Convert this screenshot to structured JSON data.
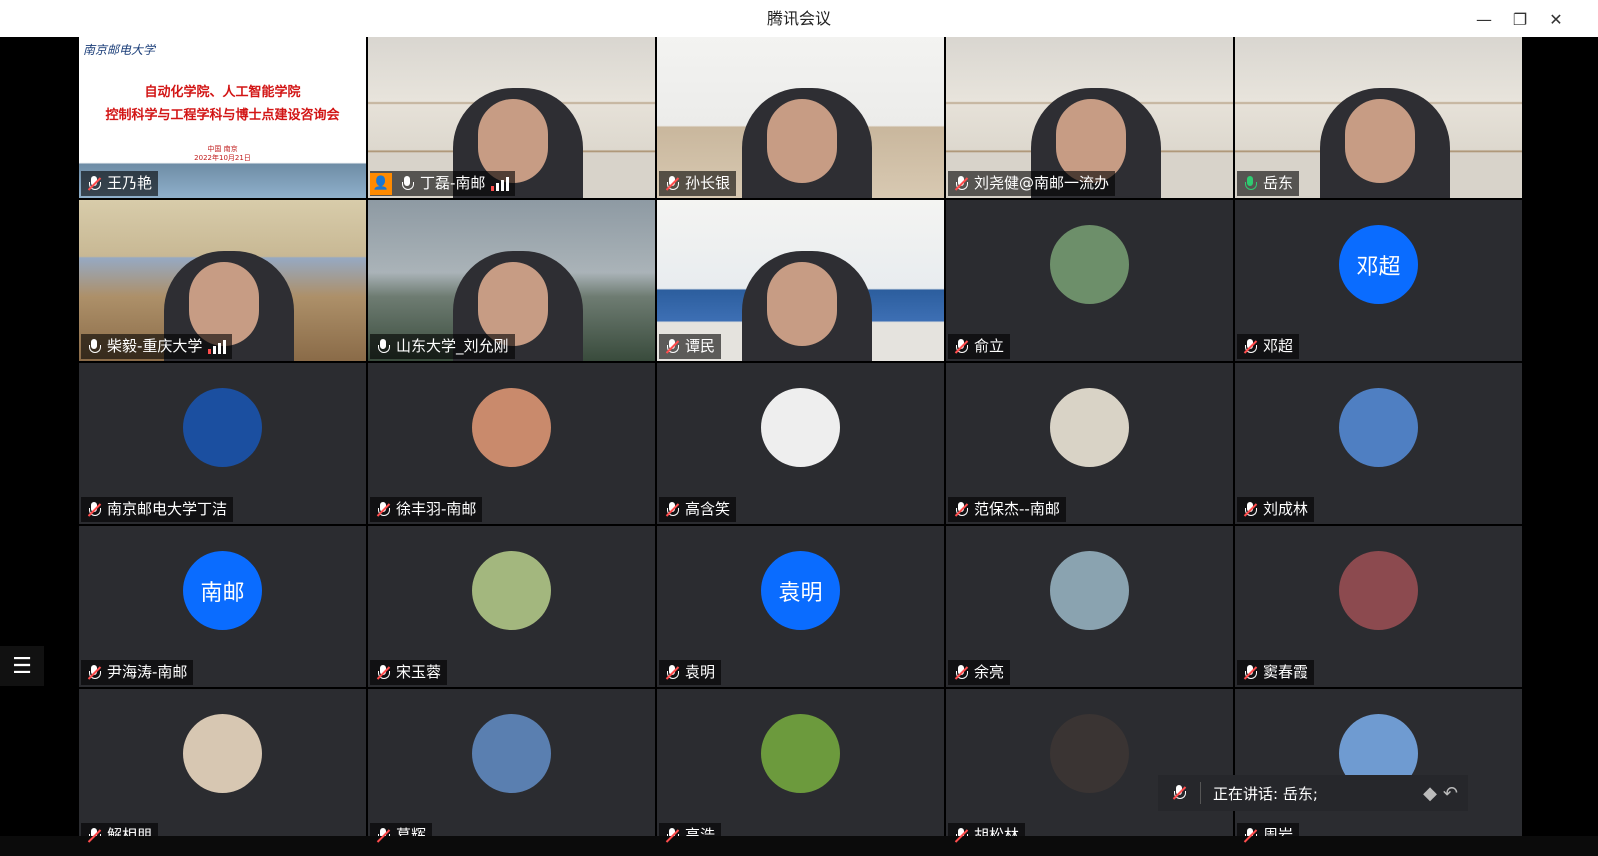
{
  "window": {
    "title": "腾讯会议",
    "minimize_icon": "—",
    "restore_icon": "❐",
    "close_icon": "✕"
  },
  "slide": {
    "logo_text": "南京邮电大学",
    "line1": "自动化学院、人工智能学院",
    "line2": "控制科学与工程学科与博士点建设咨询会",
    "location": "中国 南京",
    "date": "2022年10月21日"
  },
  "participants": [
    {
      "name": "王乃艳",
      "mic": "muted",
      "view": "slide"
    },
    {
      "name": "丁磊-南邮",
      "mic": "on",
      "view": "video",
      "bg": "shelf",
      "host": true,
      "signal": true
    },
    {
      "name": "孙长银",
      "mic": "muted",
      "view": "video",
      "bg": "living"
    },
    {
      "name": "刘尧健@南邮一流办",
      "mic": "muted",
      "view": "video",
      "bg": "shelf"
    },
    {
      "name": "岳东",
      "mic": "active",
      "view": "video",
      "bg": "shelf",
      "speaking": true
    },
    {
      "name": "柴毅-重庆大学",
      "mic": "on",
      "view": "video",
      "bg": "class",
      "signal": true
    },
    {
      "name": "山东大学_刘允刚",
      "mic": "on",
      "view": "video",
      "bg": "mount"
    },
    {
      "name": "谭民",
      "mic": "muted",
      "view": "video",
      "bg": "office"
    },
    {
      "name": "俞立",
      "mic": "muted",
      "view": "avatar",
      "avatar_color": "#6d8f6a"
    },
    {
      "name": "邓超",
      "mic": "muted",
      "view": "avatar-text",
      "avatar_text": "邓超"
    },
    {
      "name": "南京邮电大学丁洁",
      "mic": "muted",
      "view": "avatar",
      "avatar_color": "#1b4fa0"
    },
    {
      "name": "徐丰羽-南邮",
      "mic": "muted",
      "view": "avatar",
      "avatar_color": "#c98a6c"
    },
    {
      "name": "高含笑",
      "mic": "muted",
      "view": "avatar",
      "avatar_color": "#eeeeee"
    },
    {
      "name": "范保杰--南邮",
      "mic": "muted",
      "view": "avatar",
      "avatar_color": "#d9d3c6"
    },
    {
      "name": "刘成林",
      "mic": "muted",
      "view": "avatar",
      "avatar_color": "#4f7fc2"
    },
    {
      "name": "尹海涛-南邮",
      "mic": "muted",
      "view": "avatar-text",
      "avatar_text": "南邮"
    },
    {
      "name": "宋玉蓉",
      "mic": "muted",
      "view": "avatar",
      "avatar_color": "#a3b77e"
    },
    {
      "name": "袁明",
      "mic": "muted",
      "view": "avatar-text",
      "avatar_text": "袁明"
    },
    {
      "name": "余亮",
      "mic": "muted",
      "view": "avatar",
      "avatar_color": "#8aa3b0"
    },
    {
      "name": "窦春霞",
      "mic": "muted",
      "view": "avatar",
      "avatar_color": "#8c4a4f"
    },
    {
      "name": "解相朋",
      "mic": "muted",
      "view": "avatar",
      "avatar_color": "#d7c7b2"
    },
    {
      "name": "葛辉",
      "mic": "muted",
      "view": "avatar",
      "avatar_color": "#5a7fb0"
    },
    {
      "name": "高浩",
      "mic": "muted",
      "view": "avatar",
      "avatar_color": "#6c9a3d"
    },
    {
      "name": "胡松林",
      "mic": "muted",
      "view": "avatar",
      "avatar_color": "#3a3433"
    },
    {
      "name": "周岩",
      "mic": "muted",
      "view": "avatar",
      "avatar_color": "#6f9bd1"
    }
  ],
  "speaker_bar": {
    "text": "正在讲话: 岳东;",
    "mic_icon": "muted"
  },
  "side_list": {
    "icon": "☰"
  },
  "colors": {
    "speaking_border": "#2ecc71",
    "avatar_blue": "#0a6cff",
    "host_orange": "#ff8a00"
  }
}
